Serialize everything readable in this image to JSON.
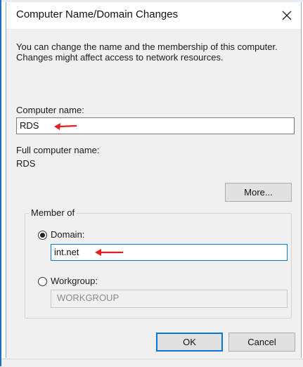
{
  "window": {
    "title": "Computer Name/Domain Changes",
    "close_icon": "close-icon"
  },
  "description": "You can change the name and the membership of this computer. Changes might affect access to network resources.",
  "computer_name": {
    "label": "Computer name:",
    "value": "RDS"
  },
  "full_computer_name": {
    "label": "Full computer name:",
    "value": "RDS"
  },
  "more_button": "More...",
  "member_of": {
    "legend": "Member of",
    "domain": {
      "label": "Domain:",
      "value": "int.net",
      "selected": true
    },
    "workgroup": {
      "label": "Workgroup:",
      "value": "WORKGROUP",
      "selected": false
    }
  },
  "buttons": {
    "ok": "OK",
    "cancel": "Cancel"
  },
  "annotations": {
    "arrow_color": "#e02020"
  }
}
